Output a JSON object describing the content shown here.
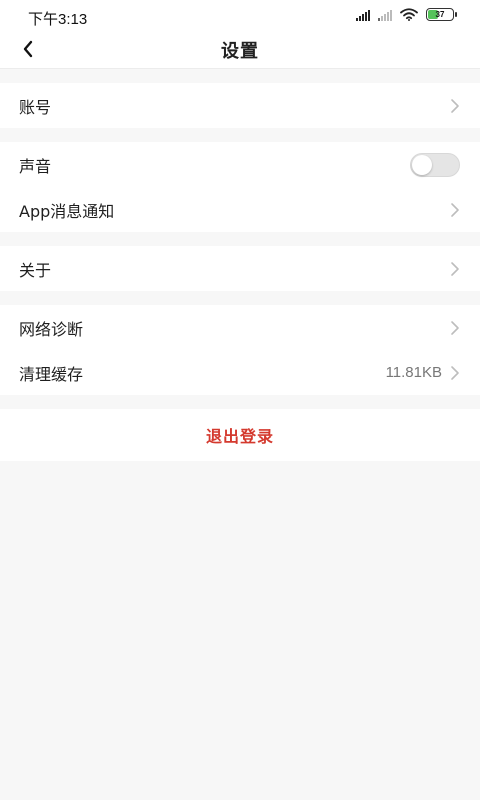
{
  "status_bar": {
    "time": "下午3:13",
    "battery": "37",
    "icons": [
      "signal-icon",
      "signal-weak-icon",
      "wifi-icon",
      "battery-icon"
    ]
  },
  "header": {
    "title": "设置",
    "back_icon": "chevron-left-icon"
  },
  "groups": [
    {
      "items": [
        {
          "label": "账号",
          "trailing": "chevron-right-icon"
        }
      ]
    },
    {
      "items": [
        {
          "label": "声音",
          "trailing": "toggle",
          "toggle_on": false
        },
        {
          "label": "App消息通知",
          "trailing": "chevron-right-icon"
        }
      ]
    },
    {
      "items": [
        {
          "label": "关于",
          "trailing": "chevron-right-icon"
        }
      ]
    },
    {
      "items": [
        {
          "label": "网络诊断",
          "trailing": "chevron-right-icon"
        },
        {
          "label": "清理缓存",
          "value": "11.81KB",
          "trailing": "chevron-right-icon"
        }
      ]
    }
  ],
  "logout": {
    "label": "退出登录"
  },
  "colors": {
    "background": "#f7f7f7",
    "logout_text": "#d4392e",
    "battery_fill": "#55c35a"
  }
}
